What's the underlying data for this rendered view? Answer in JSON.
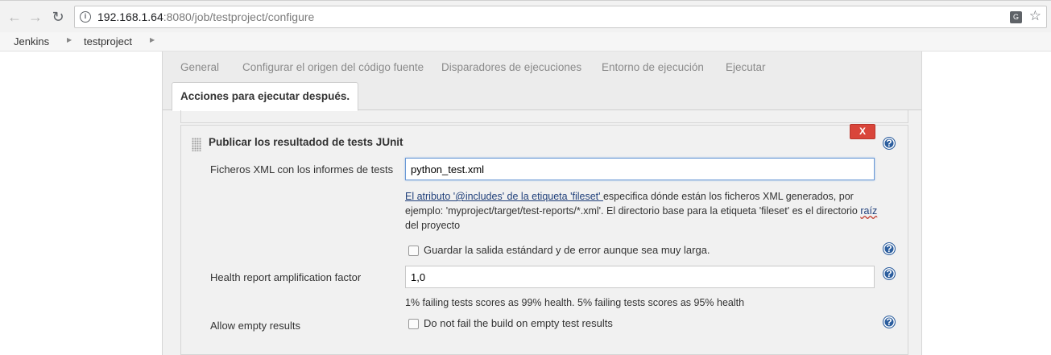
{
  "browser": {
    "url_host": "192.168.1.64",
    "url_path": ":8080/job/testproject/configure"
  },
  "breadcrumb": {
    "items": [
      "Jenkins",
      "testproject"
    ]
  },
  "tabs": {
    "items": [
      "General",
      "Configurar el origen del código fuente",
      "Disparadores de ejecuciones",
      "Entorno de ejecución",
      "Ejecutar"
    ],
    "active": "Acciones para ejecutar después."
  },
  "section": {
    "title": "Publicar los resultadod de tests JUnit",
    "delete_label": "X",
    "xml_label": "Ficheros XML con los informes de tests",
    "xml_value": "python_test.xml",
    "xml_help_link": "El atributo '@includes' de la etiqueta 'fileset' ",
    "xml_help_text1": "especifica dónde están los ficheros XML generados, por ejemplo: 'myproject/target/test-reports/*.xml'. El directorio base para la etiqueta 'fileset' es el directorio ",
    "xml_help_link2": "raíz",
    "xml_help_text2": " del proyecto",
    "keep_output_label": "Guardar la salida estándard y de error aunque sea muy larga.",
    "health_label": "Health report amplification factor",
    "health_value": "1,0",
    "health_help": "1% failing tests scores as 99% health. 5% failing tests scores as 95% health",
    "allow_empty_label": "Allow empty results",
    "allow_empty_checkbox_label": "Do not fail the build on empty test results",
    "help_glyph": "?"
  },
  "colors": {
    "delete_button": "#d9453a",
    "help_icon": "#2c5e9e",
    "link": "#1f3f7a"
  }
}
